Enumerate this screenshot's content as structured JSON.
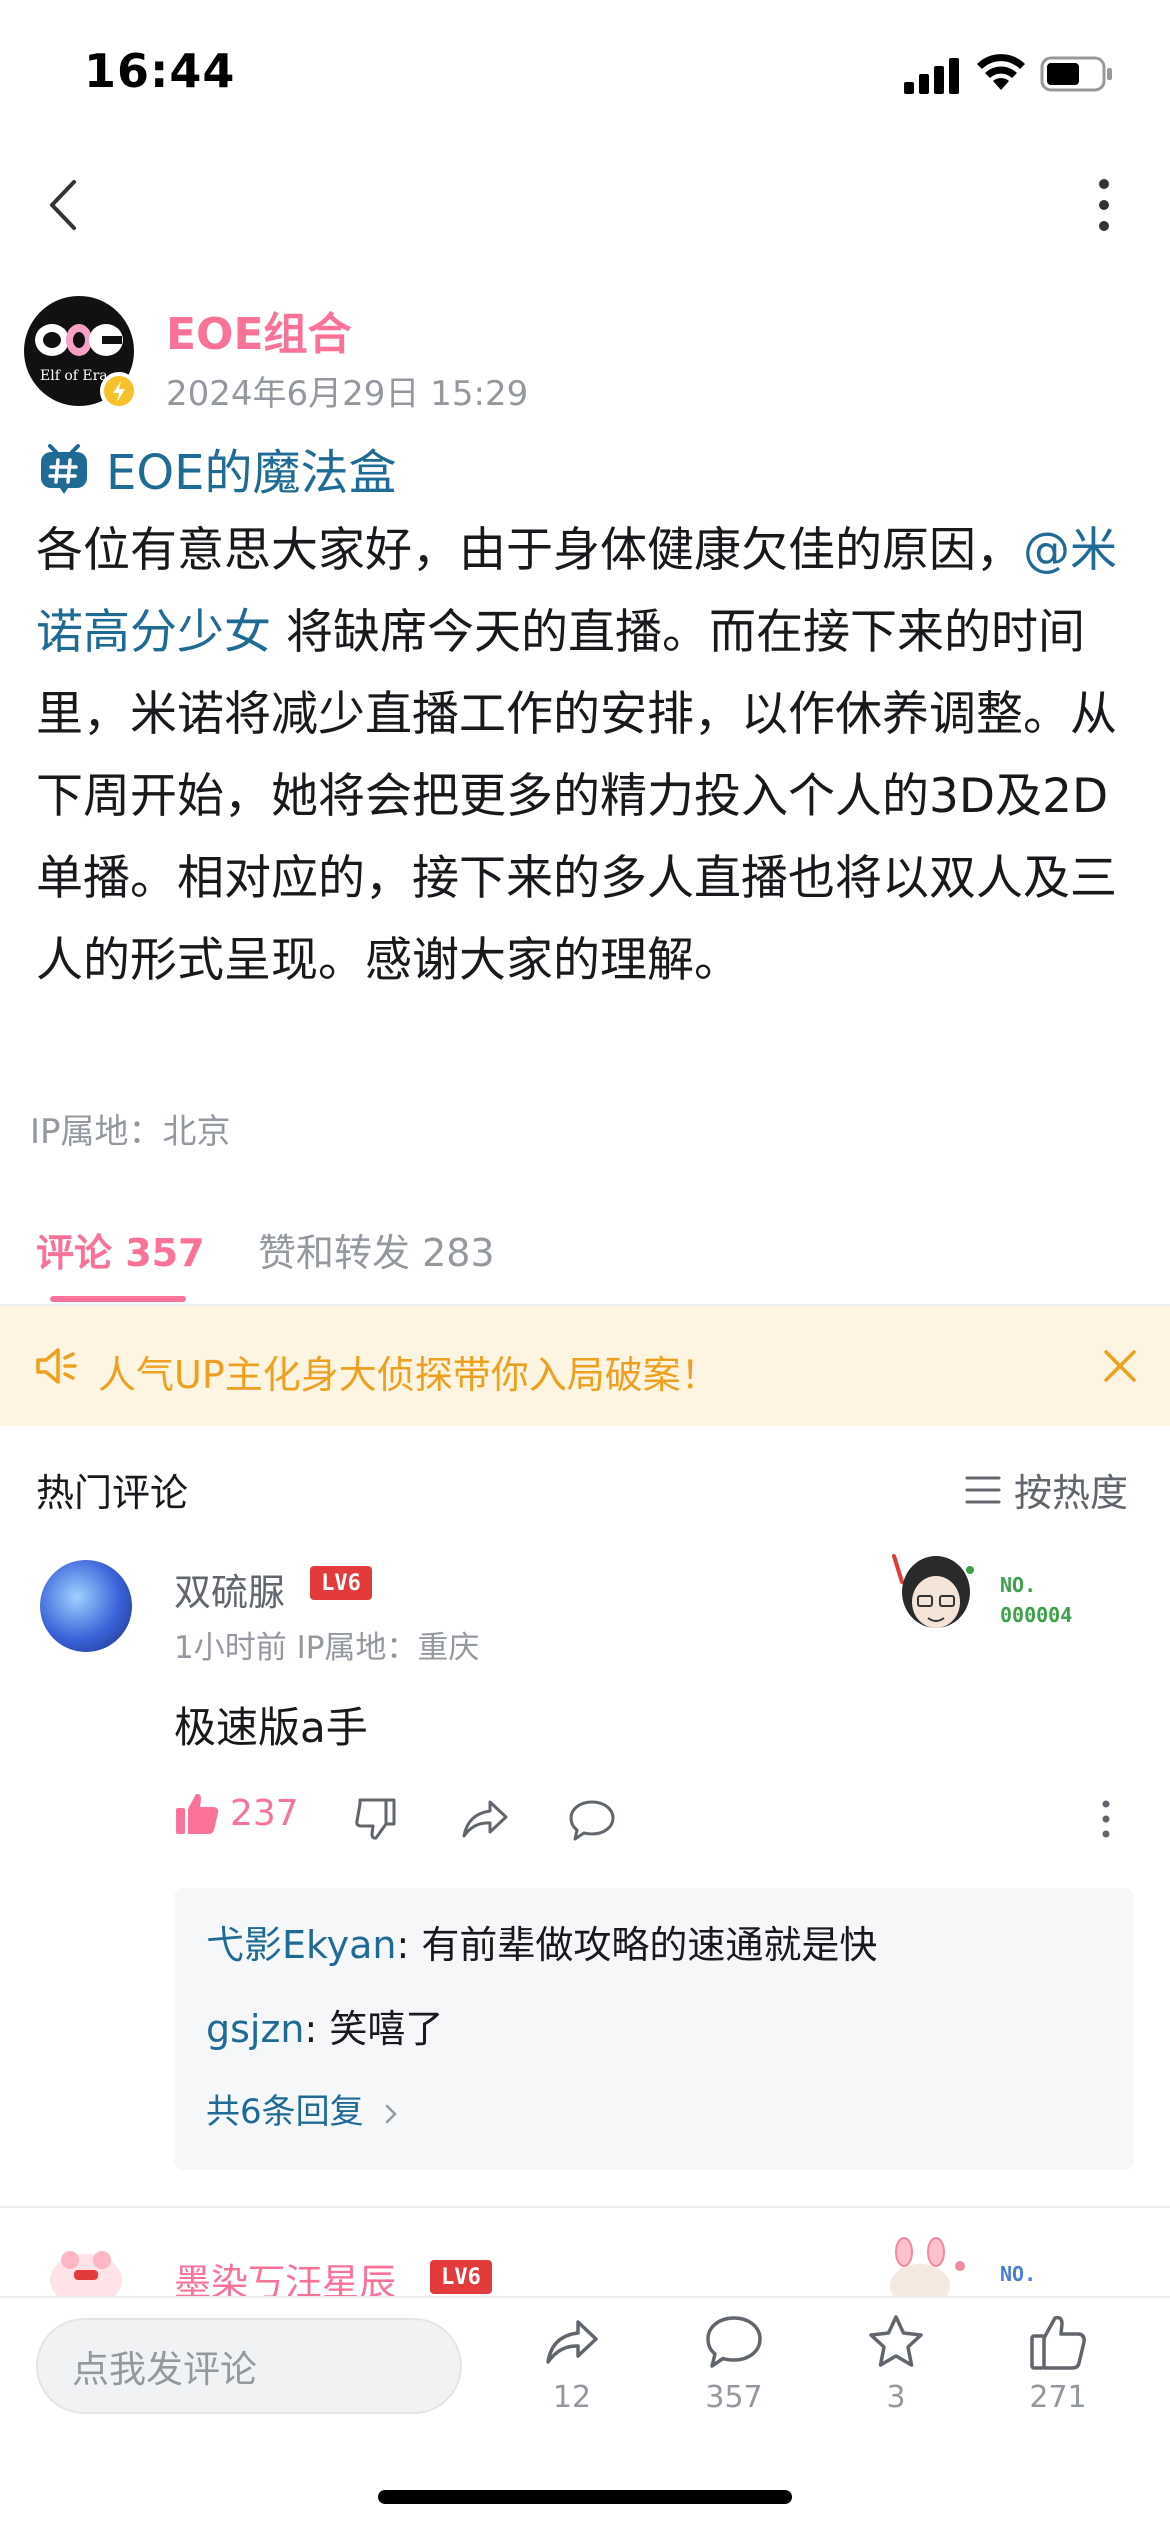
{
  "status_bar": {
    "time": "16:44"
  },
  "author": {
    "name": "EOE组合",
    "time": "2024年6月29日 15:29",
    "avatar_text": "Elf of Era"
  },
  "topic": {
    "label": "EOE的魔法盒"
  },
  "post": {
    "text_before": "各位有意思大家好，由于身体健康欠佳的原因，",
    "mention": "@米诺高分少女",
    "text_after": " 将缺席今天的直播。而在接下来的时间里，米诺将减少直播工作的安排，以作休养调整。从下周开始，她将会把更多的精力投入个人的3D及2D单播。相对应的，接下来的多人直播也将以双人及三人的形式呈现。感谢大家的理解。",
    "ip_location": "IP属地：北京"
  },
  "tabs": {
    "comments": "评论 357",
    "likes_reposts": "赞和转发 283"
  },
  "notice": {
    "text": "人气UP主化身大侦探带你入局破案！"
  },
  "hot_comments": {
    "title": "热门评论",
    "sort_label": "按热度"
  },
  "comments": [
    {
      "user": "双硫脲",
      "level": "LV6",
      "meta": "1小时前  IP属地：重庆",
      "fan_no_label": "NO.",
      "fan_no": "000004",
      "text": "极速版a手",
      "likes": "237",
      "replies": [
        {
          "user": "弋影Ekyan",
          "text": ": 有前辈做攻略的速通就是快"
        },
        {
          "user": "gsjzn",
          "text": ": 笑嘻了"
        }
      ],
      "more_replies": "共6条回复"
    },
    {
      "user": "墨染丂汪星辰",
      "level": "LV6",
      "fan_no_label": "NO."
    }
  ],
  "bottom_bar": {
    "input_placeholder": "点我发评论",
    "share_count": "12",
    "comment_count": "357",
    "favorite_count": "3",
    "like_count": "271"
  },
  "colors": {
    "accent_pink": "#fb7299",
    "link_blue": "#1f6b96",
    "notice_orange": "#f0a020",
    "notice_bg": "#fdf5e2"
  }
}
